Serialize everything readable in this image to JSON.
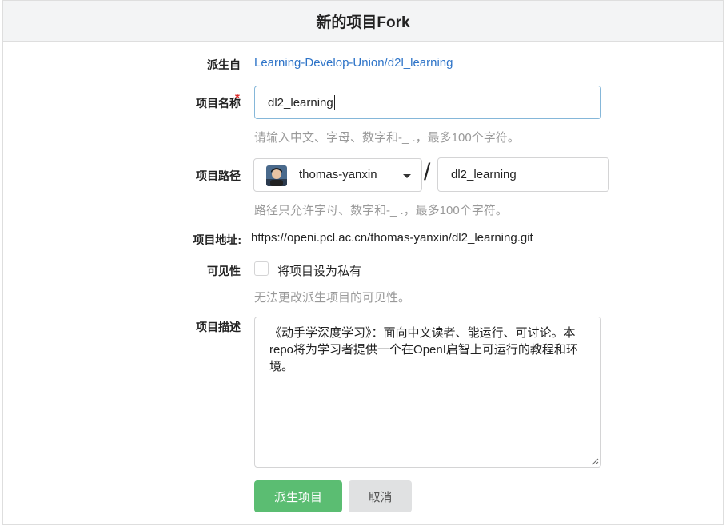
{
  "header": {
    "title": "新的项目Fork"
  },
  "form": {
    "fork_from": {
      "label": "派生自",
      "value": "Learning-Develop-Union/d2l_learning"
    },
    "repo_name": {
      "label": "项目名称",
      "required_mark": "*",
      "value": "dl2_learning",
      "help": "请输入中文、字母、数字和-_ .，最多100个字符。"
    },
    "repo_path": {
      "label": "项目路径",
      "owner": "thomas-yanxin",
      "separator": "/",
      "value": "dl2_learning",
      "help": "路径只允许字母、数字和-_ .，最多100个字符。"
    },
    "repo_url": {
      "label": "项目地址:",
      "value": "https://openi.pcl.ac.cn/thomas-yanxin/dl2_learning.git"
    },
    "visibility": {
      "label": "可见性",
      "checkbox_label": "将项目设为私有",
      "checked": false,
      "help": "无法更改派生项目的可见性。"
    },
    "description": {
      "label": "项目描述",
      "value": "《动手学深度学习》：面向中文读者、能运行、可讨论。本repo将为学习者提供一个在OpenI启智上可运行的教程和环境。"
    },
    "buttons": {
      "submit": "派生项目",
      "cancel": "取消"
    }
  },
  "colors": {
    "link": "#2e74c8",
    "primary_button": "#5bbd72",
    "secondary_button": "#e0e1e2",
    "required": "#db2828"
  }
}
